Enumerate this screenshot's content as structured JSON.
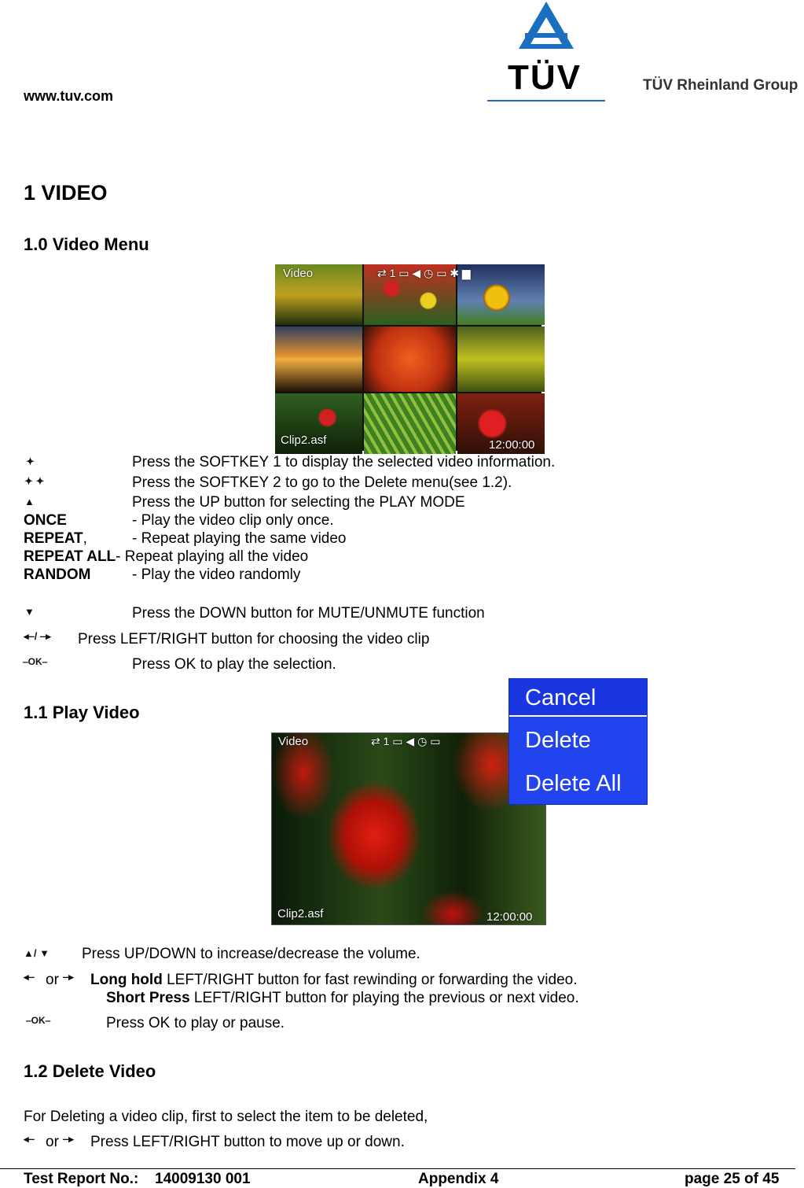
{
  "header": {
    "website": "www.tuv.com",
    "logo_text": "TÜV",
    "group": "TÜV Rheinland Group"
  },
  "title": "1 VIDEO",
  "s10": {
    "heading": "1.0 Video Menu",
    "screen": {
      "title": "Video",
      "repeat": "1",
      "clip": "Clip2.asf",
      "time": "12:00:00"
    },
    "lines": [
      {
        "icon": "softkey1-icon",
        "text": "Press the SOFTKEY 1 to display the selected video information."
      },
      {
        "icon": "softkey2-icon",
        "text": "Press the SOFTKEY 2 to go to the Delete menu(see 1.2)."
      },
      {
        "icon": "up-icon",
        "text": "Press the UP button for selecting the PLAY MODE"
      }
    ],
    "modes": [
      {
        "label": "ONCE",
        "desc": "- Play the video clip only once."
      },
      {
        "label": "REPEAT",
        "suffix": ",",
        "desc": "- Repeat playing the same video"
      },
      {
        "label": "REPEAT ALL",
        "desc": "- Repeat playing all the video"
      },
      {
        "label": "RANDOM",
        "desc": "- Play the video randomly"
      }
    ],
    "down": "Press the DOWN button for MUTE/UNMUTE function",
    "leftright": "Press LEFT/RIGHT button for choosing the video clip",
    "ok": "Press OK to play the selection."
  },
  "s11": {
    "heading": "1.1 Play Video",
    "screen": {
      "title": "Video",
      "repeat": "1",
      "clip": "Clip2.asf",
      "time": "12:00:00"
    },
    "menu": [
      "Cancel",
      "Delete",
      "Delete All"
    ],
    "updown": "Press UP/DOWN to increase/decrease the volume.",
    "or": "or",
    "long_bold": "Long hold",
    "long": " LEFT/RIGHT button for fast rewinding or forwarding the video.",
    "short_bold": "Short Press",
    "short": " LEFT/RIGHT button for playing the previous or next video.",
    "ok": "Press OK to play or pause."
  },
  "s12": {
    "heading": "1.2 Delete Video",
    "intro": "For Deleting a video clip, first to select the item to be deleted,",
    "or": "or",
    "move": "Press LEFT/RIGHT button to move up or down."
  },
  "footer": {
    "report_label": "Test Report No.:",
    "report_no": "14009130 001",
    "appendix": "Appendix 4",
    "page": "page 25 of 45"
  },
  "colors": {
    "tuv_blue": "#1a6fc0",
    "menu_blue": "#2244ee"
  }
}
